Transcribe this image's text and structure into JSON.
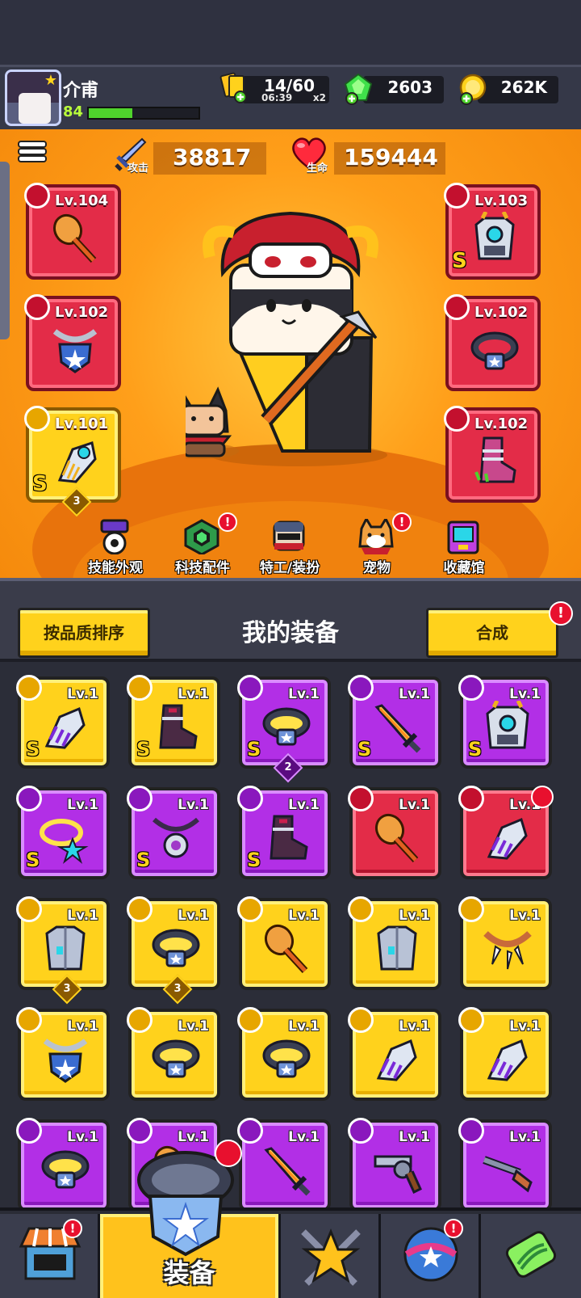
{
  "player": {
    "name": "介甫",
    "level": "84",
    "xp_fraction": 0.4
  },
  "resources": {
    "energy": {
      "value": "14/60",
      "timer": "06:39",
      "multiplier": "x2",
      "icon": "energy-cards-icon"
    },
    "gems": {
      "value": "2603",
      "icon": "green-gem-icon"
    },
    "coins": {
      "value": "262K",
      "icon": "gold-coin-icon"
    }
  },
  "stats": {
    "attack": {
      "label": "攻击",
      "value": "38817",
      "icon": "sword-icon"
    },
    "health": {
      "label": "生命",
      "value": "159444",
      "icon": "heart-icon"
    }
  },
  "equipped": {
    "left": [
      {
        "level": "Lv.104",
        "slot": "weapon",
        "rarity": "red",
        "icon": "hammer-icon"
      },
      {
        "level": "Lv.102",
        "slot": "necklace",
        "rarity": "red",
        "icon": "shield-necklace-icon"
      },
      {
        "level": "Lv.101",
        "slot": "gloves",
        "rarity": "yellow",
        "icon": "gauntlet-icon",
        "s": "S",
        "badge": "3"
      }
    ],
    "right": [
      {
        "level": "Lv.103",
        "slot": "armor",
        "rarity": "red",
        "icon": "mech-armor-icon",
        "s": "S"
      },
      {
        "level": "Lv.102",
        "slot": "belt",
        "rarity": "red",
        "icon": "belt-icon"
      },
      {
        "level": "Lv.102",
        "slot": "boots",
        "rarity": "red",
        "icon": "boots-icon"
      }
    ]
  },
  "quickbar": [
    {
      "label": "技能外观",
      "icon": "skill-skin-icon",
      "alert": false
    },
    {
      "label": "科技配件",
      "icon": "tech-parts-icon",
      "alert": true
    },
    {
      "label": "特工/装扮",
      "icon": "agent-outfit-icon",
      "alert": false
    },
    {
      "label": "宠物",
      "icon": "pet-dog-icon",
      "alert": true
    },
    {
      "label": "收藏馆",
      "icon": "collection-icon",
      "alert": false
    }
  ],
  "inventory": {
    "title": "我的装备",
    "sort_label": "按品质排序",
    "merge_label": "合成",
    "alert_mark": "!",
    "items": [
      {
        "level": "Lv.1",
        "rarity": "y",
        "icon": "gauntlet-icon",
        "s": "S"
      },
      {
        "level": "Lv.1",
        "rarity": "y",
        "icon": "boots-icon",
        "s": "S"
      },
      {
        "level": "Lv.1",
        "rarity": "p",
        "icon": "belt-icon",
        "s": "S",
        "badge": "2"
      },
      {
        "level": "Lv.1",
        "rarity": "p",
        "icon": "sword-icon",
        "s": "S"
      },
      {
        "level": "Lv.1",
        "rarity": "p",
        "icon": "mech-armor-icon",
        "s": "S"
      },
      {
        "level": "Lv.1",
        "rarity": "p",
        "icon": "star-necklace-icon",
        "s": "S"
      },
      {
        "level": "Lv.1",
        "rarity": "p",
        "icon": "gear-necklace-icon",
        "s": "S"
      },
      {
        "level": "Lv.1",
        "rarity": "p",
        "icon": "boots-icon",
        "s": "S"
      },
      {
        "level": "Lv.1",
        "rarity": "r",
        "icon": "hammer-icon"
      },
      {
        "level": "Lv.1",
        "rarity": "r",
        "icon": "gauntlet-icon",
        "new": true
      },
      {
        "level": "Lv.1",
        "rarity": "y",
        "icon": "vest-icon",
        "badge": "3"
      },
      {
        "level": "Lv.1",
        "rarity": "y",
        "icon": "belt-icon",
        "badge": "3"
      },
      {
        "level": "Lv.1",
        "rarity": "y",
        "icon": "hammer-icon"
      },
      {
        "level": "Lv.1",
        "rarity": "y",
        "icon": "vest-icon"
      },
      {
        "level": "Lv.1",
        "rarity": "y",
        "icon": "fang-necklace-icon"
      },
      {
        "level": "Lv.1",
        "rarity": "y",
        "icon": "shield-necklace-icon"
      },
      {
        "level": "Lv.1",
        "rarity": "y",
        "icon": "belt-icon"
      },
      {
        "level": "Lv.1",
        "rarity": "y",
        "icon": "belt-icon"
      },
      {
        "level": "Lv.1",
        "rarity": "y",
        "icon": "gauntlet-icon"
      },
      {
        "level": "Lv.1",
        "rarity": "y",
        "icon": "gauntlet-icon"
      },
      {
        "level": "Lv.1",
        "rarity": "p",
        "icon": "belt-icon"
      },
      {
        "level": "Lv.1",
        "rarity": "p",
        "icon": "hammer-icon"
      },
      {
        "level": "Lv.1",
        "rarity": "p",
        "icon": "sword-icon"
      },
      {
        "level": "Lv.1",
        "rarity": "p",
        "icon": "revolver-icon"
      },
      {
        "level": "Lv.1",
        "rarity": "p",
        "icon": "shotgun-icon"
      }
    ]
  },
  "nav": [
    {
      "label": "",
      "icon": "shop-icon",
      "alert": true,
      "active": false
    },
    {
      "label": "装备",
      "icon": "equipment-icon",
      "alert": true,
      "active": true
    },
    {
      "label": "",
      "icon": "battle-star-icon",
      "alert": false,
      "active": false
    },
    {
      "label": "",
      "icon": "planet-icon",
      "alert": true,
      "active": false
    },
    {
      "label": "",
      "icon": "dna-icon",
      "alert": false,
      "active": false
    }
  ]
}
